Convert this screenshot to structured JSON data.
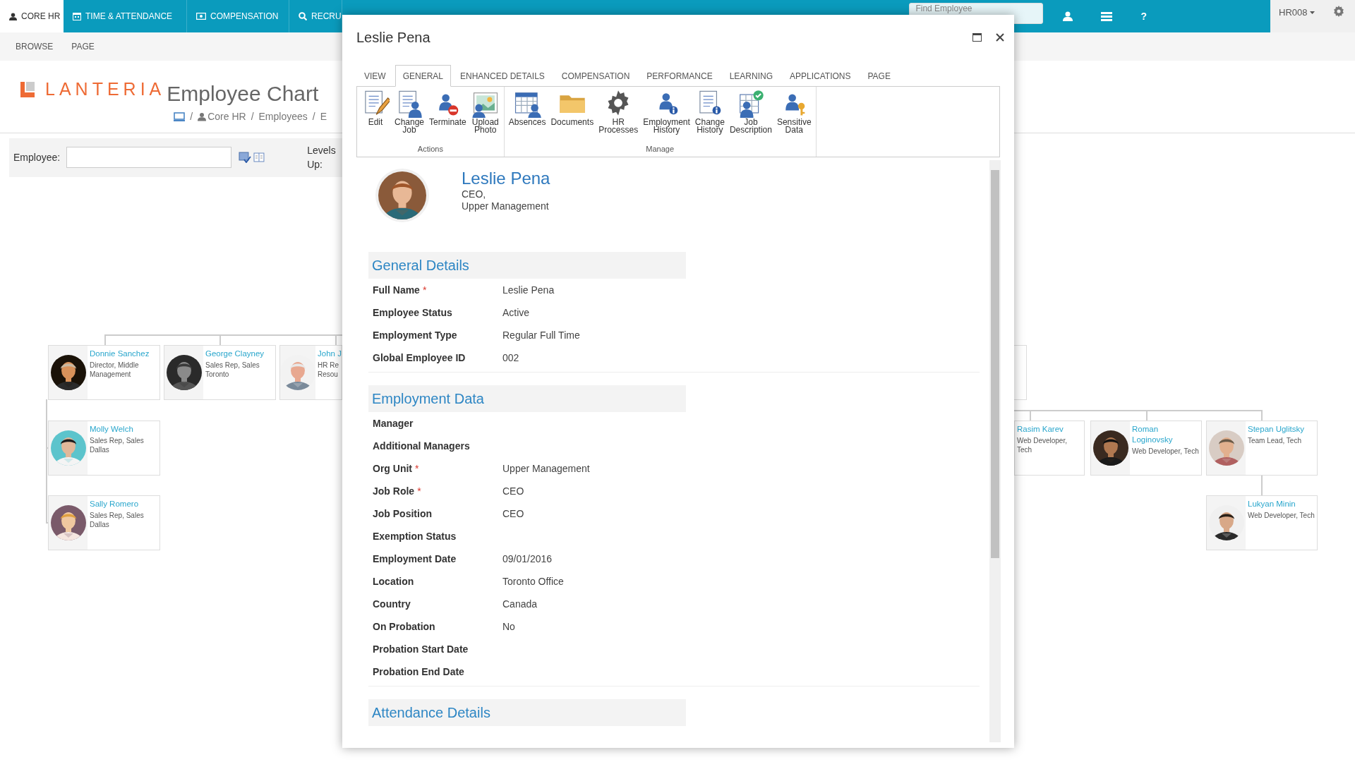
{
  "top_nav": {
    "items": [
      {
        "label": "CORE HR",
        "selected": true
      },
      {
        "label": "TIME & ATTENDANCE",
        "selected": false
      },
      {
        "label": "COMPENSATION",
        "selected": false
      },
      {
        "label": "RECRU",
        "selected": false
      }
    ],
    "search": {
      "placeholder": "Find Employee"
    },
    "help": "?",
    "user": "HR008"
  },
  "page_tabs": [
    {
      "label": "BROWSE"
    },
    {
      "label": "PAGE"
    }
  ],
  "header": {
    "logo": "LANTERIA",
    "title": "Employee Chart",
    "breadcrumb": [
      {
        "kind": "sep",
        "text": "/"
      },
      {
        "kind": "user-link",
        "text": "Core HR"
      },
      {
        "kind": "sep",
        "text": "/"
      },
      {
        "kind": "link",
        "text": "Employees"
      },
      {
        "kind": "sep",
        "text": "/"
      },
      {
        "kind": "link",
        "text": "E"
      }
    ]
  },
  "filter": {
    "employee_label": "Employee:",
    "levels_label": "Levels Up:"
  },
  "org_chart": {
    "cards": [
      {
        "name": "Donnie Sanchez",
        "details": "Director, Middle Management"
      },
      {
        "name": "George Clayney",
        "details": "Sales Rep, Sales Toronto"
      },
      {
        "name": "John J",
        "details": "HR Re Resou"
      },
      {
        "name": "Molly Welch",
        "details": "Sales Rep, Sales Dallas"
      },
      {
        "name": "Sally Romero",
        "details": "Sales Rep, Sales Dallas"
      },
      {
        "name": "Rasim Karev",
        "details": "Web Developer, Tech"
      },
      {
        "name": "Roman Loginovsky",
        "details": "Web Developer, Tech"
      },
      {
        "name": "Stepan Uglitsky",
        "details": "Team Lead, Tech"
      },
      {
        "name": "Lukyan Minin",
        "details": "Web Developer, Tech"
      }
    ]
  },
  "dialog": {
    "title": "Leslie Pena",
    "tabs": [
      {
        "label": "VIEW",
        "selected": false
      },
      {
        "label": "GENERAL",
        "selected": true
      },
      {
        "label": "ENHANCED DETAILS",
        "selected": false
      },
      {
        "label": "COMPENSATION",
        "selected": false
      },
      {
        "label": "PERFORMANCE",
        "selected": false
      },
      {
        "label": "LEARNING",
        "selected": false
      },
      {
        "label": "APPLICATIONS",
        "selected": false
      },
      {
        "label": "PAGE",
        "selected": false
      }
    ],
    "ribbon": [
      {
        "label": "Actions",
        "buttons": [
          "Edit",
          "Change Job",
          "Terminate",
          "Upload Photo"
        ]
      },
      {
        "label": "Manage",
        "buttons": [
          "Absences",
          "Documents",
          "HR Processes",
          "Employment History",
          "Change History",
          "Job Description",
          "Sensitive Data"
        ]
      }
    ],
    "profile": {
      "name": "Leslie Pena",
      "line1": "CEO,",
      "line2": "Upper Management"
    },
    "sections": [
      {
        "title": "General Details",
        "fields": [
          {
            "label": "Full Name",
            "marker": "*",
            "value": "Leslie Pena"
          },
          {
            "label": "Employee Status",
            "value": "Active"
          },
          {
            "label": "Employment Type",
            "value": "Regular Full Time"
          },
          {
            "label": "Global Employee ID",
            "value": "002"
          }
        ]
      },
      {
        "title": "Employment Data",
        "fields": [
          {
            "label": "Manager"
          },
          {
            "label": "Additional Managers"
          },
          {
            "label": "Org Unit",
            "marker": "*",
            "value": "Upper Management"
          },
          {
            "label": "Job Role",
            "marker": "*",
            "value": "CEO"
          },
          {
            "label": "Job Position",
            "value": "CEO"
          },
          {
            "label": "Exemption Status"
          },
          {
            "label": "Employment Date",
            "value": "09/01/2016"
          },
          {
            "label": "Location",
            "value": "Toronto Office"
          },
          {
            "label": "Country",
            "value": "Canada"
          },
          {
            "label": "On Probation",
            "value": "No"
          },
          {
            "label": "Probation Start Date"
          },
          {
            "label": "Probation End Date"
          }
        ]
      },
      {
        "title": "Attendance Details"
      }
    ]
  }
}
